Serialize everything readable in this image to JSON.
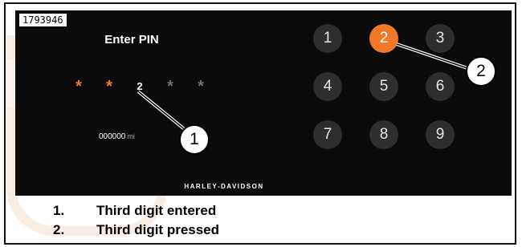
{
  "image_id": "1793946",
  "screen": {
    "title": "Enter PIN",
    "pin_display": [
      {
        "char": "*",
        "state": "filled"
      },
      {
        "char": "*",
        "state": "filled"
      },
      {
        "char": "2",
        "state": "current"
      },
      {
        "char": "*",
        "state": "empty"
      },
      {
        "char": "*",
        "state": "empty"
      }
    ],
    "odometer": {
      "value": "000000",
      "unit": "mi"
    },
    "keypad": {
      "keys": [
        "1",
        "2",
        "3",
        "4",
        "5",
        "6",
        "7",
        "8",
        "9"
      ],
      "active_key": "2"
    },
    "brand": "HARLEY-DAVIDSON"
  },
  "callouts": [
    "1",
    "2"
  ],
  "legend": [
    {
      "num": "1.",
      "text": "Third digit entered"
    },
    {
      "num": "2.",
      "text": "Third digit pressed"
    }
  ],
  "colors": {
    "accent": "#f07a27",
    "screen_bg": "#0b0b0b",
    "key_bg": "#2e2e2e"
  }
}
